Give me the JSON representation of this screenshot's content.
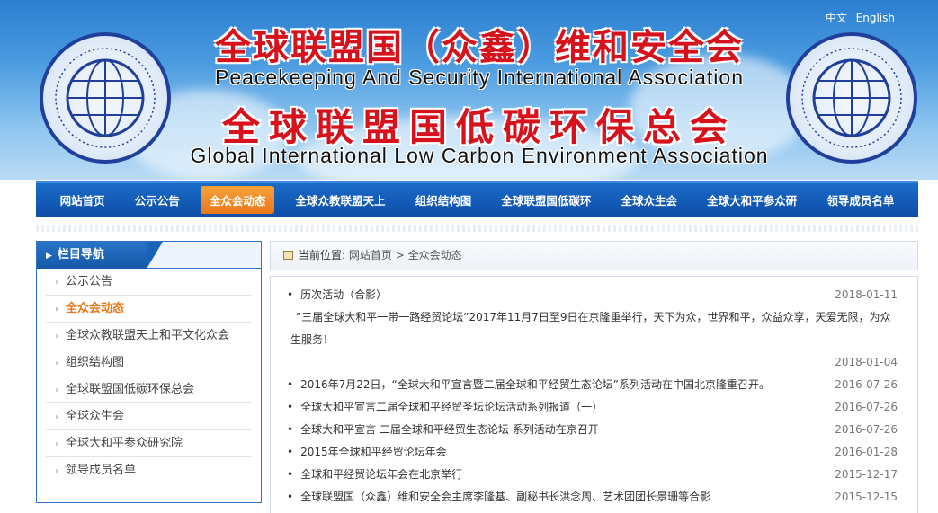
{
  "header": {
    "title_cn_1": "全球联盟国（众鑫）维和安全会",
    "title_en_1": "Peacekeeping And Security International Association",
    "title_cn_2": "全球联盟国低碳环保总会",
    "title_en_2": "Global International Low Carbon Environment  Association",
    "lang_cn": "中文",
    "lang_en": "English"
  },
  "nav": {
    "items": [
      "网站首页",
      "公示公告",
      "全众会动态",
      "全球众教联盟天上",
      "组织结构图",
      "全球联盟国低碳环",
      "全球众生会",
      "全球大和平参众研",
      "领导成员名单"
    ],
    "active_index": 2
  },
  "sidebar": {
    "heading": "栏目导航",
    "items": [
      "公示公告",
      "全众会动态",
      "全球众教联盟天上和平文化众会",
      "组织结构图",
      "全球联盟国低碳环保总会",
      "全球众生会",
      "全球大和平参众研究院",
      "领导成员名单"
    ],
    "active_index": 1
  },
  "breadcrumb": {
    "label": "当前位置:",
    "home": "网站首页",
    "separator": ">",
    "current": "全众会动态"
  },
  "news": {
    "first_title": "历次活动（合影）",
    "first_date": "2018-01-11",
    "description": "“三届全球大和平一带一路经贸论坛”2017年11月7日至9日在京隆重举行，天下为众，世界和平，众益众享，天爱无限，为众生服务！",
    "description_date": "2018-01-04",
    "items": [
      {
        "title": "2016年7月22日，“全球大和平宣言暨二届全球和平经贸生态论坛”系列活动在中国北京隆重召开。",
        "date": "2016-07-26"
      },
      {
        "title": "全球大和平宣言二届全球和平经贸圣坛论坛活动系列报道（一）",
        "date": "2016-07-26"
      },
      {
        "title": "全球大和平宣言 二届全球和平经贸生态论坛 系列活动在京召开",
        "date": "2016-07-26"
      },
      {
        "title": "2015年全球和平经贸论坛年会",
        "date": "2016-01-28"
      },
      {
        "title": "全球和平经贸论坛年会在北京举行",
        "date": "2015-12-17"
      },
      {
        "title": "全球联盟国（众鑫）维和安全会主席李隆基、副秘书长洪念周、艺术团团长景珊等合影",
        "date": "2015-12-15"
      }
    ]
  },
  "colors": {
    "nav_bg": "#0d4ea8",
    "active_tab": "#e9781a",
    "title_red": "#d6121c",
    "active_side": "#e9781a"
  }
}
